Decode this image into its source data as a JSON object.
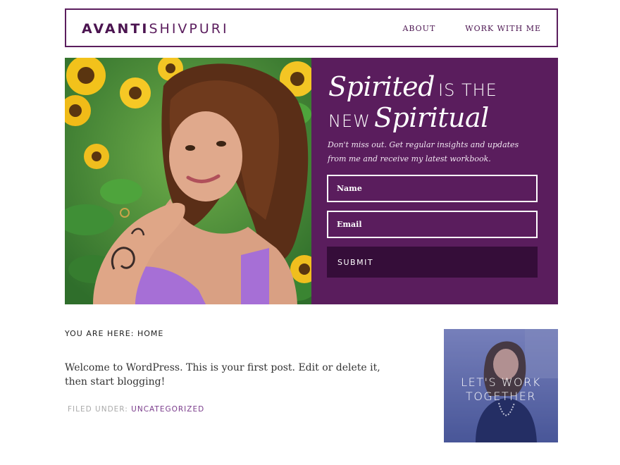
{
  "header": {
    "logo_first": "AVANTI",
    "logo_last": "SHIVPURI",
    "nav": [
      "ABOUT",
      "WORK WITH ME"
    ]
  },
  "hero": {
    "headline_script_1": "Spirited",
    "headline_plain_1": "IS THE",
    "headline_plain_2": "NEW",
    "headline_script_2": "Spiritual",
    "tagline": "Don't miss out. Get regular insights and updates from me and receive my latest workbook.",
    "name_placeholder": "Name",
    "email_placeholder": "Email",
    "submit_label": "SUBMIT"
  },
  "content": {
    "breadcrumb": "YOU ARE HERE: HOME",
    "post_text": "Welcome to WordPress. This is your first post. Edit or delete it, then start blogging!",
    "filed_under_label": "FILED UNDER:",
    "category": "UNCATEGORIZED"
  },
  "sidebar": {
    "widget_line1": "LET'S WORK",
    "widget_line2": "TOGETHER"
  },
  "colors": {
    "brand_purple": "#5a1d5d",
    "dark_purple": "#350d39",
    "link_purple": "#7b3d8c"
  }
}
